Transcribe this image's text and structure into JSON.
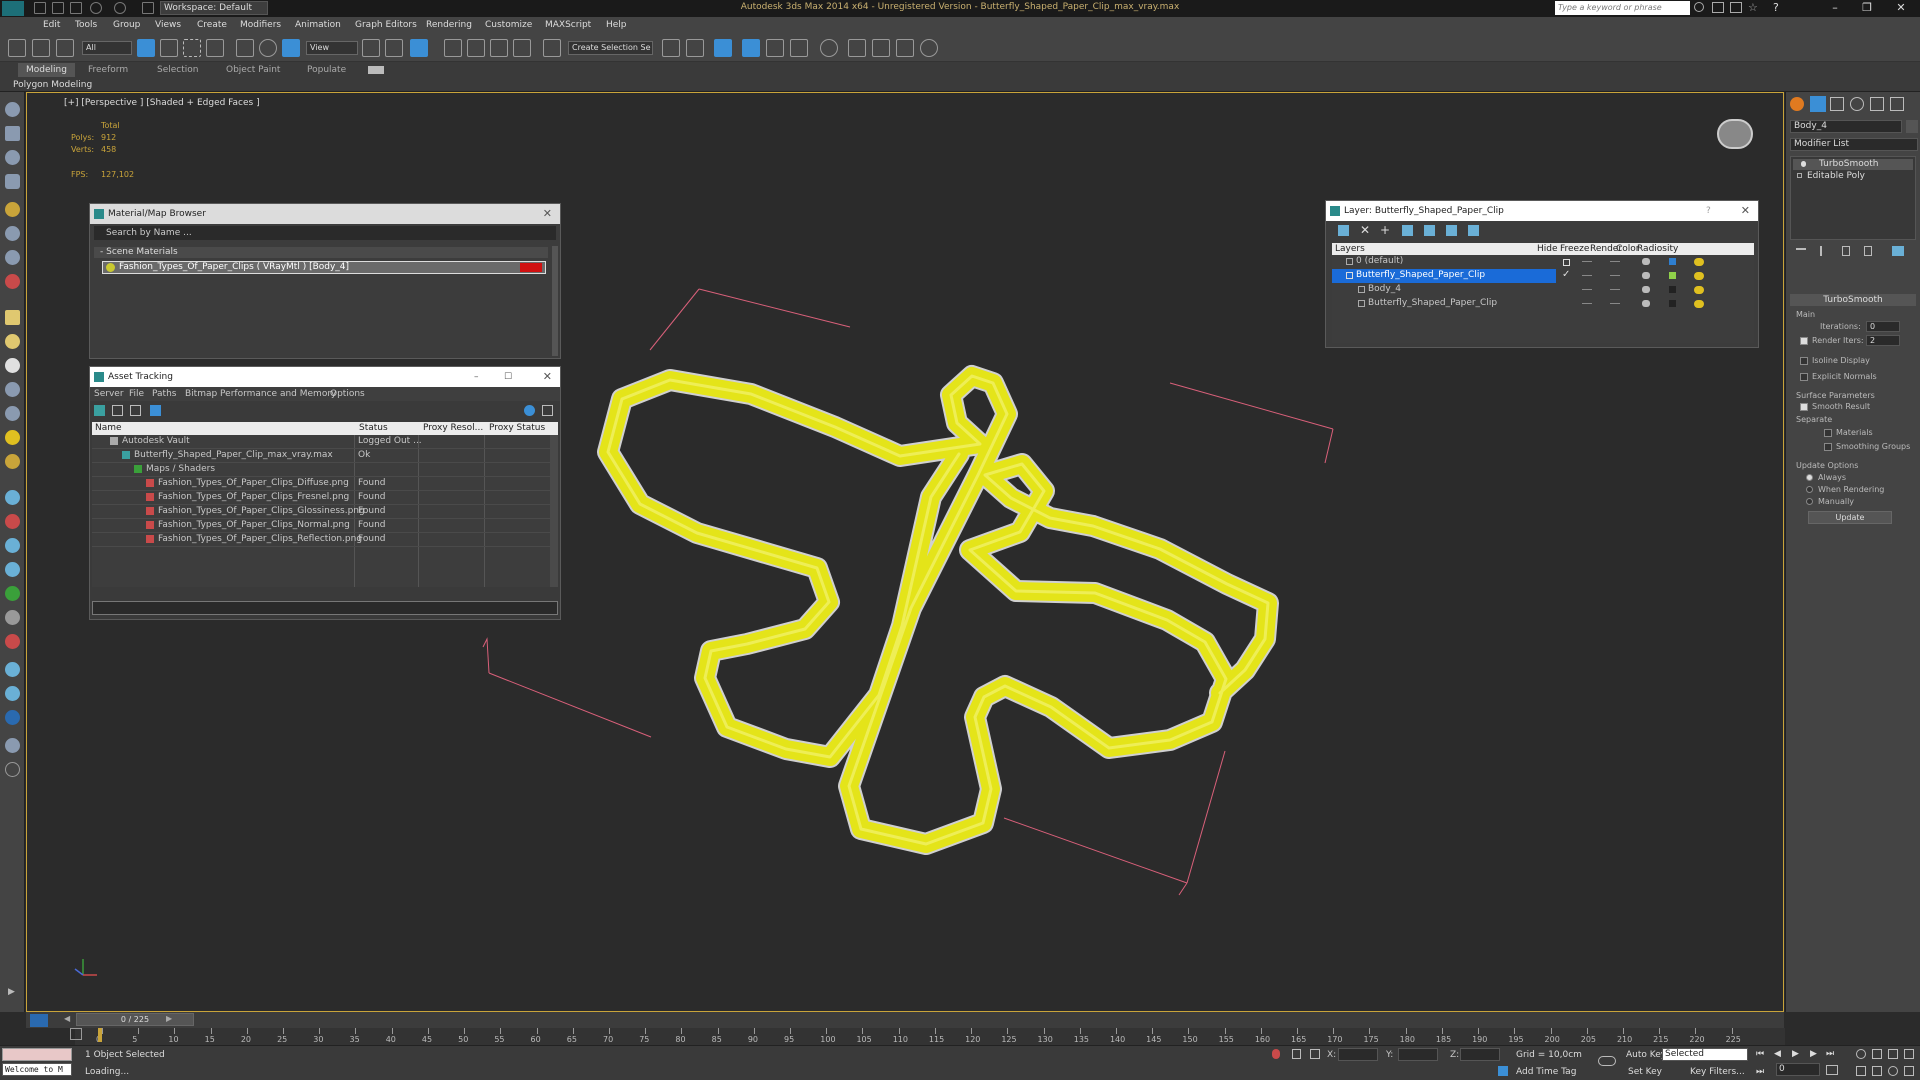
{
  "window": {
    "title": "Autodesk 3ds Max 2014 x64  -  Unregistered Version  -  Butterfly_Shaped_Paper_Clip_max_vray.max",
    "workspace": "Workspace: Default",
    "search_placeholder": "Type a keyword or phrase"
  },
  "menu": [
    "Edit",
    "Tools",
    "Group",
    "Views",
    "Create",
    "Modifiers",
    "Animation",
    "Graph Editors",
    "Rendering",
    "Customize",
    "MAXScript",
    "Help"
  ],
  "toolbar": {
    "filter_select": "All",
    "ref_coord_select": "View",
    "named_selection": "Create Selection Se"
  },
  "ribbon": {
    "tabs": [
      "Modeling",
      "Freeform",
      "Selection",
      "Object Paint",
      "Populate"
    ],
    "subtab": "Polygon Modeling"
  },
  "viewport": {
    "label": "[+] [Perspective ] [Shaded + Edged Faces ]",
    "stats": {
      "total_label": "Total",
      "polys_label": "Polys:",
      "polys_value": "912",
      "verts_label": "Verts:",
      "verts_value": "458",
      "fps_label": "FPS:",
      "fps_value": "127,102"
    },
    "object_color": "#e4e419",
    "bbox_color": "#d9607a"
  },
  "material_browser": {
    "title": "Material/Map Browser",
    "search": "Search by Name ...",
    "group": "- Scene Materials",
    "item": "Fashion_Types_Of_Paper_Clips  ( VRayMtl ) [Body_4]"
  },
  "asset_tracking": {
    "title": "Asset Tracking",
    "menu": [
      "Server",
      "File",
      "Paths",
      "Bitmap Performance and Memory",
      "Options"
    ],
    "columns": [
      "Name",
      "Status",
      "Proxy Resol...",
      "Proxy Status"
    ],
    "rows": [
      {
        "name": "Autodesk Vault",
        "status": "Logged Out ..."
      },
      {
        "name": "Butterfly_Shaped_Paper_Clip_max_vray.max",
        "status": "Ok"
      },
      {
        "name": "Maps / Shaders",
        "status": ""
      },
      {
        "name": "Fashion_Types_Of_Paper_Clips_Diffuse.png",
        "status": "Found"
      },
      {
        "name": "Fashion_Types_Of_Paper_Clips_Fresnel.png",
        "status": "Found"
      },
      {
        "name": "Fashion_Types_Of_Paper_Clips_Glossiness.png",
        "status": "Found"
      },
      {
        "name": "Fashion_Types_Of_Paper_Clips_Normal.png",
        "status": "Found"
      },
      {
        "name": "Fashion_Types_Of_Paper_Clips_Reflection.png",
        "status": "Found"
      }
    ]
  },
  "layer_manager": {
    "title": "Layer: Butterfly_Shaped_Paper_Clip",
    "columns": [
      "Layers",
      "Hide",
      "Freeze",
      "Render",
      "Color",
      "Radiosity"
    ],
    "rows": [
      {
        "name": "0 (default)",
        "color": "#2f7fd0"
      },
      {
        "name": "Butterfly_Shaped_Paper_Clip",
        "color": "#8fd04a"
      },
      {
        "name": "Body_4",
        "color": "#222222"
      },
      {
        "name": "Butterfly_Shaped_Paper_Clip",
        "color": "#222222"
      }
    ]
  },
  "command_panel": {
    "object_name": "Body_4",
    "modifier_list": "Modifier List",
    "stack": [
      "TurboSmooth",
      "Editable Poly"
    ],
    "rollout_title": "TurboSmooth",
    "main_label": "Main",
    "iterations_label": "Iterations:",
    "iterations_value": "0",
    "render_iters_label": "Render Iters:",
    "render_iters_value": "2",
    "isoline": "Isoline Display",
    "explicit_normals": "Explicit Normals",
    "surface_params": "Surface Parameters",
    "smooth_result": "Smooth Result",
    "separate": "Separate",
    "materials": "Materials",
    "smoothing_groups": "Smoothing Groups",
    "update_options": "Update Options",
    "always": "Always",
    "when_rendering": "When Rendering",
    "manually": "Manually",
    "update_button": "Update"
  },
  "timeline": {
    "frame": "0 / 225",
    "ticks": [
      "0",
      "5",
      "10",
      "15",
      "20",
      "25",
      "30",
      "35",
      "40",
      "45",
      "50",
      "55",
      "60",
      "65",
      "70",
      "75",
      "80",
      "85",
      "90",
      "95",
      "100",
      "105",
      "110",
      "115",
      "120",
      "125",
      "130",
      "135",
      "140",
      "145",
      "150",
      "155",
      "160",
      "165",
      "170",
      "175",
      "180",
      "185",
      "190",
      "195",
      "200",
      "205",
      "210",
      "215",
      "220",
      "225"
    ]
  },
  "status": {
    "maxscript": "Welcome to M",
    "selected": "1 Object Selected",
    "prompt": "Loading...",
    "x_label": "X:",
    "y_label": "Y:",
    "z_label": "Z:",
    "grid": "Grid = 10,0cm",
    "auto_key": "Auto Key",
    "set_key": "Set Key",
    "selected_dropdown": "Selected",
    "key_filters": "Key Filters...",
    "add_time_tag": "Add Time Tag",
    "frame_value": "0"
  }
}
